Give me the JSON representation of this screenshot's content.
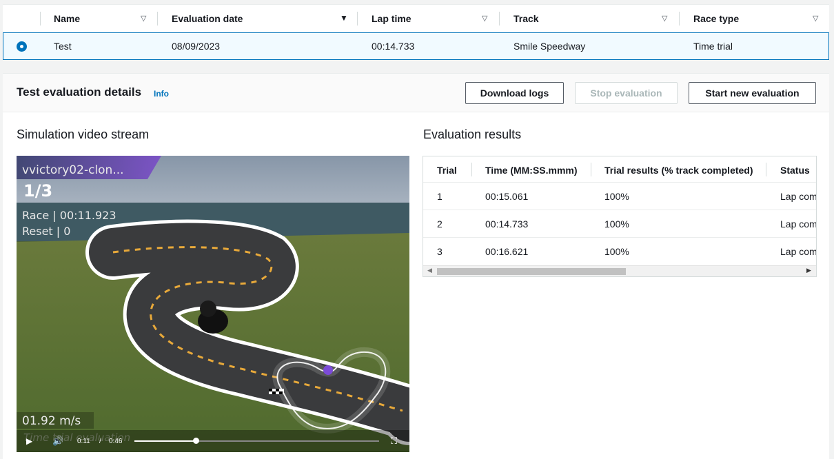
{
  "top_table": {
    "headers": [
      "Name",
      "Evaluation date",
      "Lap time",
      "Track",
      "Race type"
    ],
    "row": {
      "name": "Test",
      "evaluation_date": "08/09/2023",
      "lap_time": "00:14.733",
      "track": "Smile Speedway",
      "race_type": "Time trial"
    }
  },
  "details": {
    "title": "Test evaluation details",
    "info_label": "Info",
    "download_logs_label": "Download logs",
    "stop_evaluation_label": "Stop evaluation",
    "start_new_label": "Start new evaluation"
  },
  "video": {
    "section_title": "Simulation video stream",
    "model_name": "vvictory02-clon...",
    "lap_counter": "1/3",
    "race_time": "Race | 00:11.923",
    "reset_count": "Reset | 0",
    "speed": "01.92 m/s",
    "mode_text": "Time trial evaluation",
    "current_time": "0:11",
    "duration": "0:46",
    "progress": 0.25
  },
  "results": {
    "section_title": "Evaluation results",
    "headers": [
      "Trial",
      "Time (MM:SS.mmm)",
      "Trial results (% track completed)",
      "Status"
    ],
    "rows": [
      {
        "trial": "1",
        "time": "00:15.061",
        "result": "100%",
        "status": "Lap complete"
      },
      {
        "trial": "2",
        "time": "00:14.733",
        "result": "100%",
        "status": "Lap complete"
      },
      {
        "trial": "3",
        "time": "00:16.621",
        "result": "100%",
        "status": "Lap complete"
      }
    ]
  },
  "colors": {
    "accent": "#0073bb",
    "selected_bg": "#f1faff"
  }
}
